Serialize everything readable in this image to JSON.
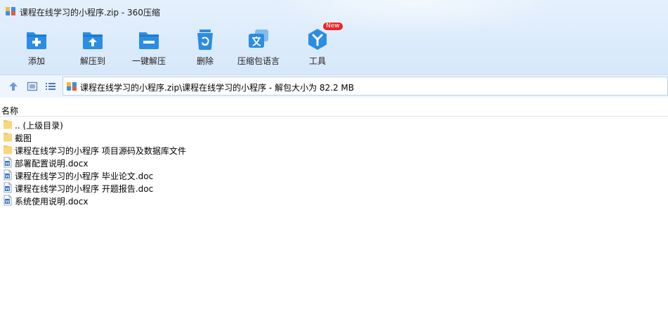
{
  "window": {
    "title": "课程在线学习的小程序.zip - 360压缩"
  },
  "toolbar": {
    "items": [
      {
        "label": "添加",
        "icon": "add-icon"
      },
      {
        "label": "解压到",
        "icon": "extract-to-icon"
      },
      {
        "label": "一键解压",
        "icon": "one-click-extract-icon"
      },
      {
        "label": "删除",
        "icon": "delete-icon"
      },
      {
        "label": "压缩包语言",
        "icon": "archive-language-icon"
      },
      {
        "label": "工具",
        "icon": "tools-icon",
        "badge": "New"
      }
    ]
  },
  "addressbar": {
    "path": "课程在线学习的小程序.zip\\课程在线学习的小程序 - 解包大小为 82.2 MB"
  },
  "list": {
    "column_name": "名称",
    "files": [
      {
        "name": ".. (上级目录)",
        "type": "folder"
      },
      {
        "name": "截图",
        "type": "folder"
      },
      {
        "name": "课程在线学习的小程序 项目源码及数据库文件",
        "type": "folder"
      },
      {
        "name": "部署配置说明.docx",
        "type": "word"
      },
      {
        "name": "课程在线学习的小程序 毕业论文.doc",
        "type": "word"
      },
      {
        "name": "课程在线学习的小程序 开题报告.doc",
        "type": "word"
      },
      {
        "name": "系统使用说明.docx",
        "type": "word"
      }
    ]
  },
  "colors": {
    "accent": "#2b8de3",
    "badge": "#e8262d",
    "folder": "#f6c75a"
  }
}
